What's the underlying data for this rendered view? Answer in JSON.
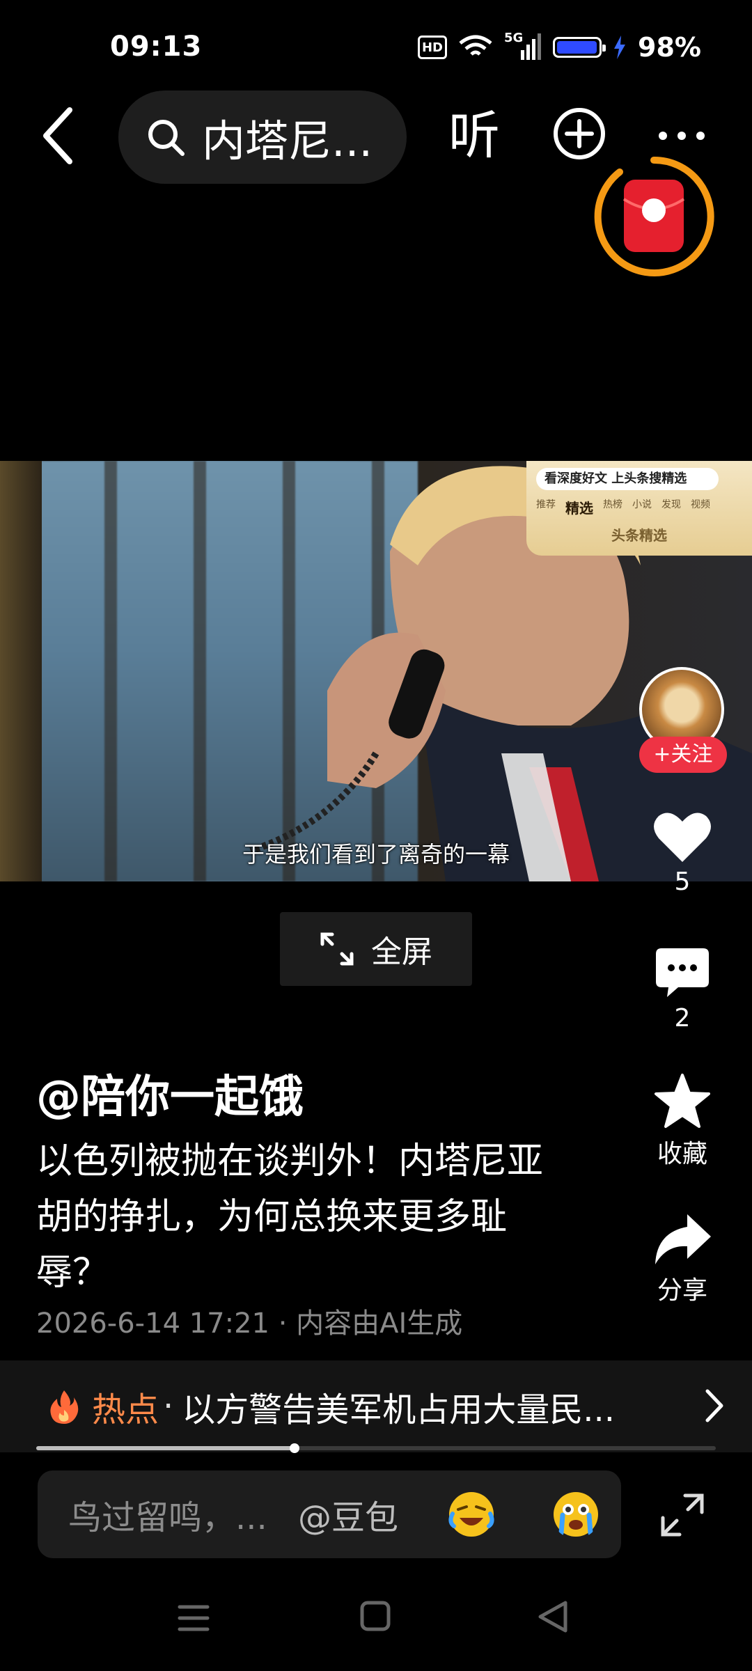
{
  "status_bar": {
    "time": "09:13",
    "hd_badge": "HD",
    "network": "5G",
    "battery_percent": "98%",
    "battery_level": 0.98,
    "icons": [
      "hd-icon",
      "wifi-icon",
      "signal-icon",
      "battery-icon",
      "charging-icon"
    ]
  },
  "top_bar": {
    "search_text": "内塔尼...",
    "listen_label": "听",
    "icons": [
      "back-icon",
      "search-icon",
      "add-icon",
      "more-icon",
      "red-packet-icon"
    ]
  },
  "video": {
    "subtitle": "于是我们看到了离奇的一幕",
    "promo_card": {
      "search_text": "看深度好文 上头条搜精选",
      "tabs": [
        "推荐",
        "精选",
        "热榜",
        "小说",
        "发现",
        "视频"
      ],
      "active_tab": "精选",
      "brand": "头条精选"
    }
  },
  "actions": {
    "follow_label": "+关注",
    "like_count": "5",
    "comment_count": "2",
    "favorite_label": "收藏",
    "share_label": "分享"
  },
  "fullscreen_label": "全屏",
  "post": {
    "author": "@陪你一起饿",
    "title": "以色列被抛在谈判外！内塔尼亚胡的挣扎，为何总换来更多耻辱？",
    "meta": "2026-6-14 17:21 · 内容由AI生成"
  },
  "hot": {
    "label": "热点",
    "separator": "·",
    "text": "以方警告美军机占用大量民..."
  },
  "progress_fraction": 0.38,
  "comment_bar": {
    "placeholder": "鸟过留鸣，...",
    "mention": "@豆包",
    "emojis": [
      "laughing-crying-emoji-icon",
      "crying-emoji-icon"
    ]
  },
  "nav_bar": {
    "icons": [
      "menu-icon",
      "home-icon",
      "back-triangle-icon"
    ]
  },
  "colors": {
    "follow_red": "#ee3344",
    "hot_orange": "#ff8a4a",
    "redpacket_ring": "#f59a14",
    "battery_blue": "#2f4bff"
  }
}
